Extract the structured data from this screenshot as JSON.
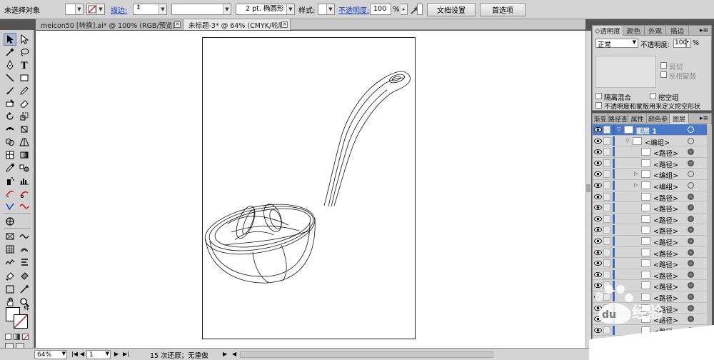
{
  "control_bar": {
    "selection_label": "未选择对象",
    "stroke_label": "描边:",
    "stroke_weight_arrow": "⇕",
    "brush_value": "2 pt. 椭圆形",
    "style_label": "样式:",
    "opacity_label": "不透明度:",
    "opacity_value": "100",
    "opacity_unit": "%",
    "doc_setup_button": "文档设置",
    "preferences_button": "首选项"
  },
  "tabs": [
    {
      "label": "meicon50 [转换].ai* @ 100% (RGB/预览)"
    },
    {
      "label": "未标题-3* @ 64% (CMYK/轮廓)"
    }
  ],
  "transparency_panel": {
    "tabs": [
      "透明度",
      "颜色",
      "外观",
      "描边"
    ],
    "blend_mode": "正常",
    "opacity_label": "不透明度:",
    "opacity_value": "100",
    "opacity_unit": "%",
    "clip_label": "剪切",
    "invert_mask_label": "反相蒙版",
    "isolate_label": "隔离混合",
    "knockout_label": "挖空组",
    "opacity_mask_label": "不透明度和蒙版用来定义挖空形状"
  },
  "layers_panel": {
    "tabs": [
      "渐变",
      "路径查",
      "属性",
      "颜色参",
      "图层"
    ],
    "rows": [
      {
        "name": "图层 1",
        "type": "layer",
        "indent": 0,
        "expand": "▽",
        "target": "hollow"
      },
      {
        "name": "<编组>",
        "type": "group",
        "indent": 1,
        "expand": "▽",
        "target": "hollow"
      },
      {
        "name": "<路径>",
        "type": "path",
        "indent": 2,
        "expand": "",
        "target": "filled"
      },
      {
        "name": "<路径>",
        "type": "path",
        "indent": 2,
        "expand": "",
        "target": "filled"
      },
      {
        "name": "<编组>",
        "type": "group",
        "indent": 2,
        "expand": "▷",
        "target": "hollow"
      },
      {
        "name": "<编组>",
        "type": "group",
        "indent": 2,
        "expand": "▷",
        "target": "hollow"
      },
      {
        "name": "<路径>",
        "type": "path",
        "indent": 2,
        "expand": "",
        "target": "filled"
      },
      {
        "name": "<路径>",
        "type": "path",
        "indent": 2,
        "expand": "",
        "target": "filled"
      },
      {
        "name": "<路径>",
        "type": "path",
        "indent": 2,
        "expand": "",
        "target": "filled"
      },
      {
        "name": "<路径>",
        "type": "path",
        "indent": 2,
        "expand": "",
        "target": "filled"
      },
      {
        "name": "<路径>",
        "type": "path",
        "indent": 2,
        "expand": "",
        "target": "filled"
      },
      {
        "name": "<路径>",
        "type": "path",
        "indent": 2,
        "expand": "",
        "target": "filled"
      },
      {
        "name": "<路径>",
        "type": "path",
        "indent": 2,
        "expand": "",
        "target": "filled"
      },
      {
        "name": "<路径>",
        "type": "path",
        "indent": 2,
        "expand": "",
        "target": "filled"
      },
      {
        "name": "<路径>",
        "type": "path",
        "indent": 2,
        "expand": "",
        "target": "filled"
      },
      {
        "name": "<路径>",
        "type": "path",
        "indent": 2,
        "expand": "",
        "target": "filled"
      },
      {
        "name": "<路径>",
        "type": "path",
        "indent": 2,
        "expand": "",
        "target": "filled"
      },
      {
        "name": "<路径>",
        "type": "path",
        "indent": 2,
        "expand": "",
        "target": "filled"
      },
      {
        "name": "<路径>",
        "type": "path",
        "indent": 2,
        "expand": "",
        "target": "filled"
      },
      {
        "name": "<路径>",
        "type": "path",
        "indent": 2,
        "expand": "",
        "target": "filled"
      }
    ]
  },
  "status_bar": {
    "zoom_value": "64%",
    "artboard_value": "1",
    "undo_text": "15 次还原；无重做"
  },
  "colors": {
    "layer_highlight": "#4a78c9",
    "link_blue": "#1b40c8",
    "stroke_red": "#d01010"
  },
  "watermark": "du 经验"
}
